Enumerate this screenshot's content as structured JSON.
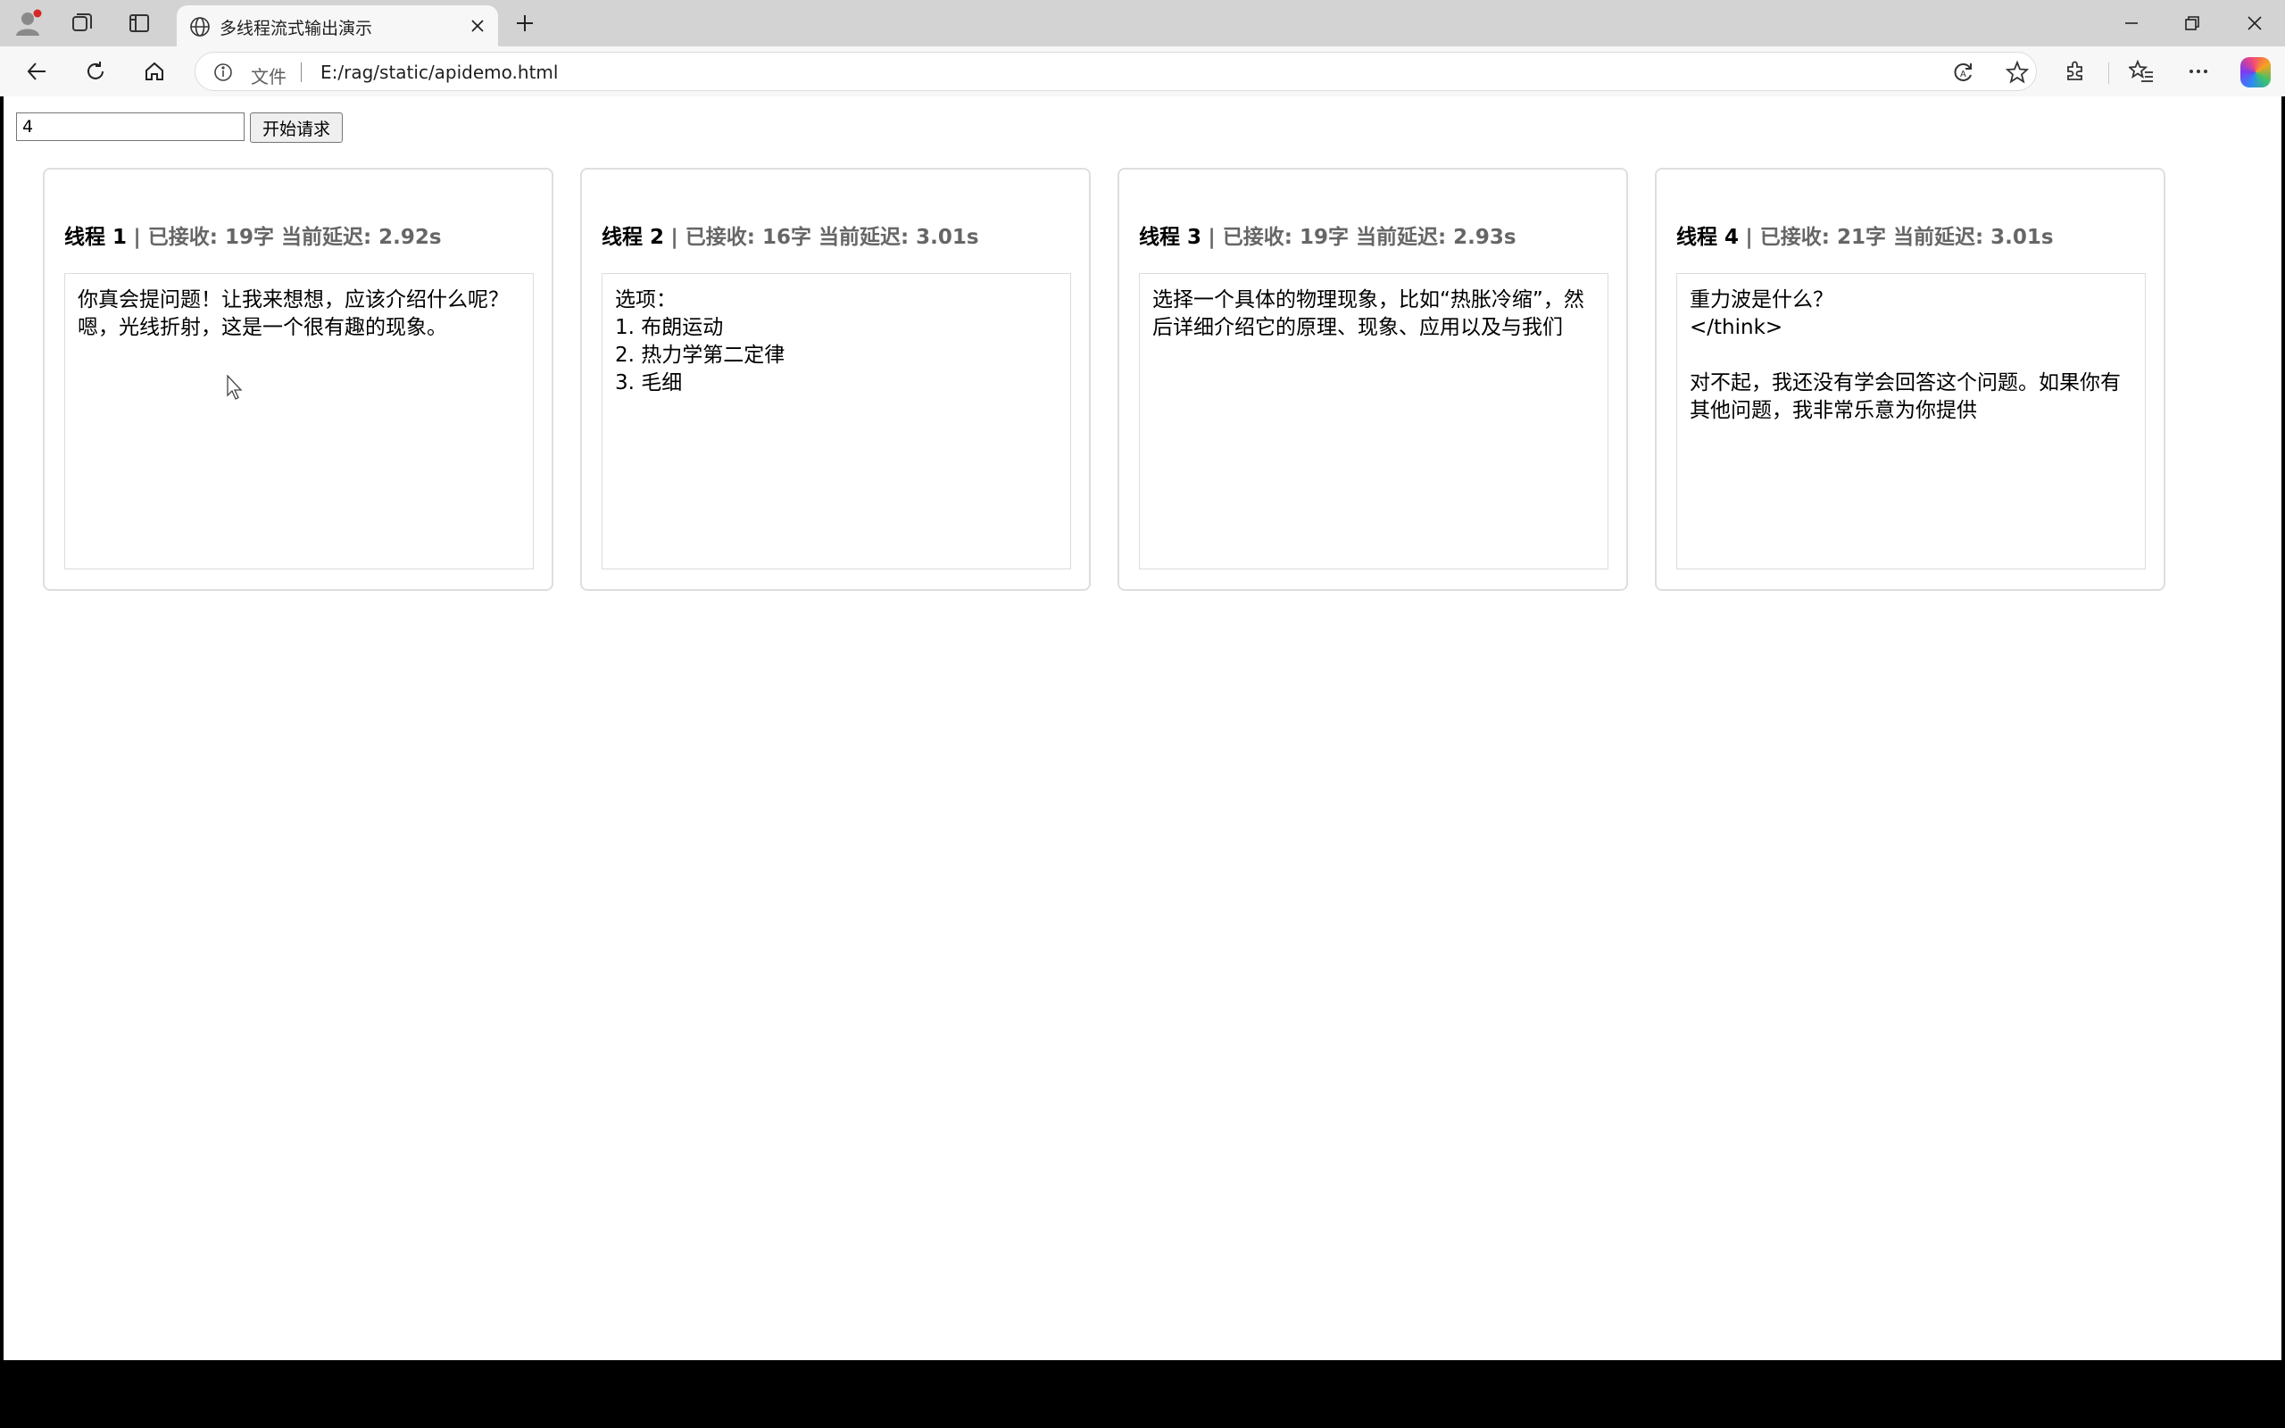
{
  "browser": {
    "tab_title": "多线程流式输出演示",
    "address": {
      "scheme_label": "文件",
      "url": "E:/rag/static/apidemo.html"
    }
  },
  "page": {
    "controls": {
      "count_value": "4",
      "start_label": "开始请求"
    },
    "threads": [
      {
        "name": "线程 1",
        "meta": "| 已接收: 19字 当前延迟: 2.92s",
        "text": "你真会提问题！让我来想想，应该介绍什么呢？嗯，光线折射，这是一个很有趣的现象。"
      },
      {
        "name": "线程 2",
        "meta": "| 已接收: 16字 当前延迟: 3.01s",
        "text": "选项：\n1. 布朗运动\n2. 热力学第二定律\n3. 毛细"
      },
      {
        "name": "线程 3",
        "meta": "| 已接收: 19字 当前延迟: 2.93s",
        "text": "选择一个具体的物理现象，比如“热胀冷缩”，然后详细介绍它的原理、现象、应用以及与我们"
      },
      {
        "name": "线程 4",
        "meta": "| 已接收: 21字 当前延迟: 3.01s",
        "text": "重力波是什么？\n</think>\n\n对不起，我还没有学会回答这个问题。如果你有其他问题，我非常乐意为你提供"
      }
    ]
  },
  "colors": {
    "titlebar": "#d3d3d3",
    "toolbar": "#f7f7f7",
    "meta_text": "#666666",
    "card_border": "#dedede"
  },
  "icons": [
    "profile-icon",
    "collections-icon",
    "tab-actions-icon",
    "globe-icon",
    "close-icon",
    "plus-icon",
    "minimize-icon",
    "restore-icon",
    "back-icon",
    "refresh-icon",
    "home-icon",
    "info-icon",
    "read-aloud-icon",
    "star-icon",
    "extensions-icon",
    "favorites-icon",
    "more-icon",
    "copilot-icon",
    "mouse-cursor-icon"
  ]
}
